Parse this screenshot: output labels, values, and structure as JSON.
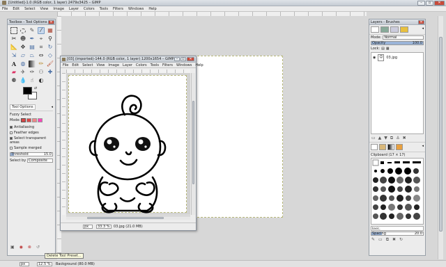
{
  "main": {
    "title": "[Untitled]-1.0 (RGB color, 1 layer) 2479x3425 – GIMP",
    "menu": [
      "File",
      "Edit",
      "Select",
      "View",
      "Image",
      "Layer",
      "Colors",
      "Tools",
      "Filters",
      "Windows",
      "Help"
    ],
    "zoom": "12.5 %",
    "unit": "px",
    "status": "Background (80.0 MB)"
  },
  "toolbox": {
    "title": "Toolbox - Tool Options",
    "tab": "Tool Options",
    "tool_name": "Fuzzy Select",
    "mode_label": "Mode:",
    "antialiasing": "Antialiasing",
    "feather": "Feather edges",
    "transparent": "Select transparent areas",
    "merged": "Sample merged",
    "threshold_label": "Threshold",
    "threshold_value": "15.0",
    "select_by_label": "Select by",
    "select_by_value": "Composite",
    "tooltip": "Delete Tool Preset...",
    "tool_icons": [
      "rect-select",
      "ellipse-select",
      "free-select",
      "fuzzy-select",
      "color-select",
      "scissors",
      "foreground-select",
      "paths",
      "color-picker",
      "zoom",
      "measure",
      "move",
      "align",
      "crop",
      "rotate",
      "scale",
      "shear",
      "perspective",
      "flip",
      "cage",
      "text",
      "bucket-fill",
      "blend",
      "pencil",
      "paintbrush",
      "eraser",
      "airbrush",
      "ink",
      "clone",
      "heal",
      "perspective-clone",
      "blur",
      "smudge",
      "dodge-burn"
    ]
  },
  "image_win": {
    "title": "[03] (imported)-144.0 (RGB color, 1 layer) 1200x1654 – GIMP",
    "menu": [
      "File",
      "Edit",
      "Select",
      "View",
      "Image",
      "Layer",
      "Colors",
      "Tools",
      "Filters",
      "Windows",
      "Help"
    ],
    "zoom": "33.3 %",
    "unit": "px",
    "status": "03.jpg (21.0 MB)"
  },
  "layers": {
    "title": "Layers - Brushes",
    "mode_label": "Mode:",
    "mode_value": "Normal",
    "opacity_label": "Opacity",
    "opacity_value": "100.0",
    "lock_label": "Lock:",
    "layer_name": "03.jpg",
    "brush_label": "Clipboard (17 × 17)",
    "spacing_label": "Spacing",
    "spacing_value": "20.0",
    "basic_label": "basic,"
  }
}
